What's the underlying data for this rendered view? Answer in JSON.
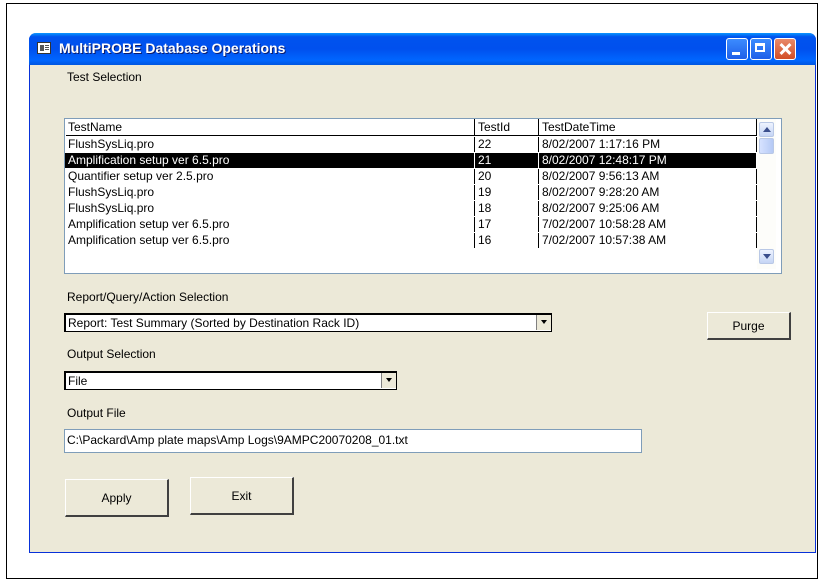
{
  "window": {
    "title": "MultiPROBE Database Operations"
  },
  "test_selection": {
    "label": "Test Selection",
    "columns": [
      "TestName",
      "TestId",
      "TestDateTime"
    ],
    "rows": [
      {
        "name": "FlushSysLiq.pro",
        "id": "22",
        "datetime": "8/02/2007 1:17:16 PM"
      },
      {
        "name": "Amplification setup ver 6.5.pro",
        "id": "21",
        "datetime": "8/02/2007 12:48:17 PM",
        "selected": true
      },
      {
        "name": "Quantifier setup ver 2.5.pro",
        "id": "20",
        "datetime": "8/02/2007 9:56:13 AM"
      },
      {
        "name": "FlushSysLiq.pro",
        "id": "19",
        "datetime": "8/02/2007 9:28:20 AM"
      },
      {
        "name": "FlushSysLiq.pro",
        "id": "18",
        "datetime": "8/02/2007 9:25:06 AM"
      },
      {
        "name": "Amplification setup ver 6.5.pro",
        "id": "17",
        "datetime": "7/02/2007 10:58:28 AM"
      },
      {
        "name": "Amplification setup ver 6.5.pro",
        "id": "16",
        "datetime": "7/02/2007 10:57:38 AM"
      }
    ]
  },
  "report_selection": {
    "label": "Report/Query/Action Selection",
    "value": "Report: Test Summary (Sorted by Destination Rack ID)"
  },
  "purge_button": "Purge",
  "output_selection": {
    "label": "Output Selection",
    "value": "File"
  },
  "output_file": {
    "label": "Output File",
    "value": "C:\\Packard\\Amp plate maps\\Amp Logs\\9AMPC20070208_01.txt"
  },
  "buttons": {
    "apply": "Apply",
    "exit": "Exit"
  },
  "colors": {
    "titlebar": "#0054e3",
    "window_bg": "#ece9d8",
    "selection": "#000000"
  }
}
